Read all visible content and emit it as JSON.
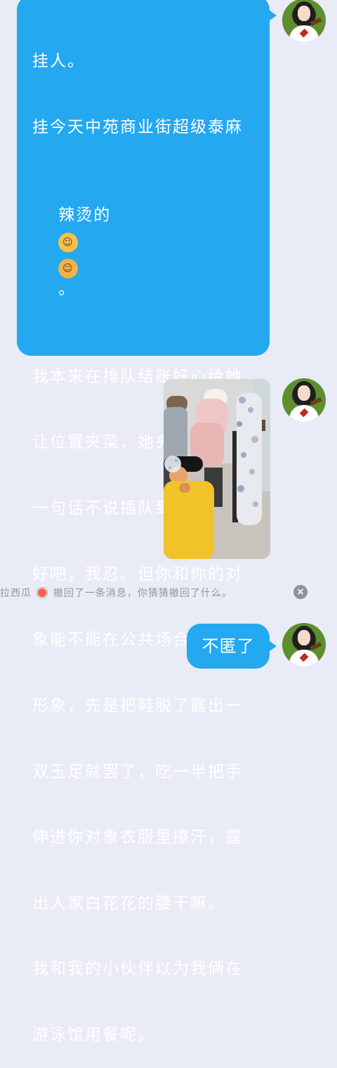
{
  "messages": [
    {
      "type": "text",
      "sender": "me",
      "lines": [
        "挂人。",
        "挂今天中苑商业街超级泰麻",
        "辣烫的",
        "我本来在排队结账好心给她",
        "让位置夹菜，她夹完了直接",
        "一句话不说插队到我前面。",
        "好吧，我忍。但你和你的对",
        "象能不能在公共场合注意点",
        "形象，先是把鞋脱了露出一",
        "双玉足就罢了，吃一半把手",
        "伸进你对象衣服里擦汗，露",
        "出人家白花花的腰干嘛。",
        "我和我的小伙伴以为我俩在",
        "游泳馆用餐呢。"
      ],
      "emoji_line_index": 2,
      "emoji_suffix": "。",
      "emoji_icons": [
        "man-face-emoji",
        "woman-face-emoji"
      ]
    },
    {
      "type": "image",
      "sender": "me"
    },
    {
      "type": "text",
      "sender": "me",
      "text": "不匿了"
    }
  ],
  "recall_notice": {
    "prefix": "拉西瓜",
    "suffix": "撤回了一条消息，你猜猜撤回了什么。",
    "icon": "watermelon-icon",
    "close_icon": "close-icon"
  },
  "colors": {
    "background": "#e9ecf6",
    "bubble": "#24a8ef",
    "notice_text": "#8f96a0"
  }
}
